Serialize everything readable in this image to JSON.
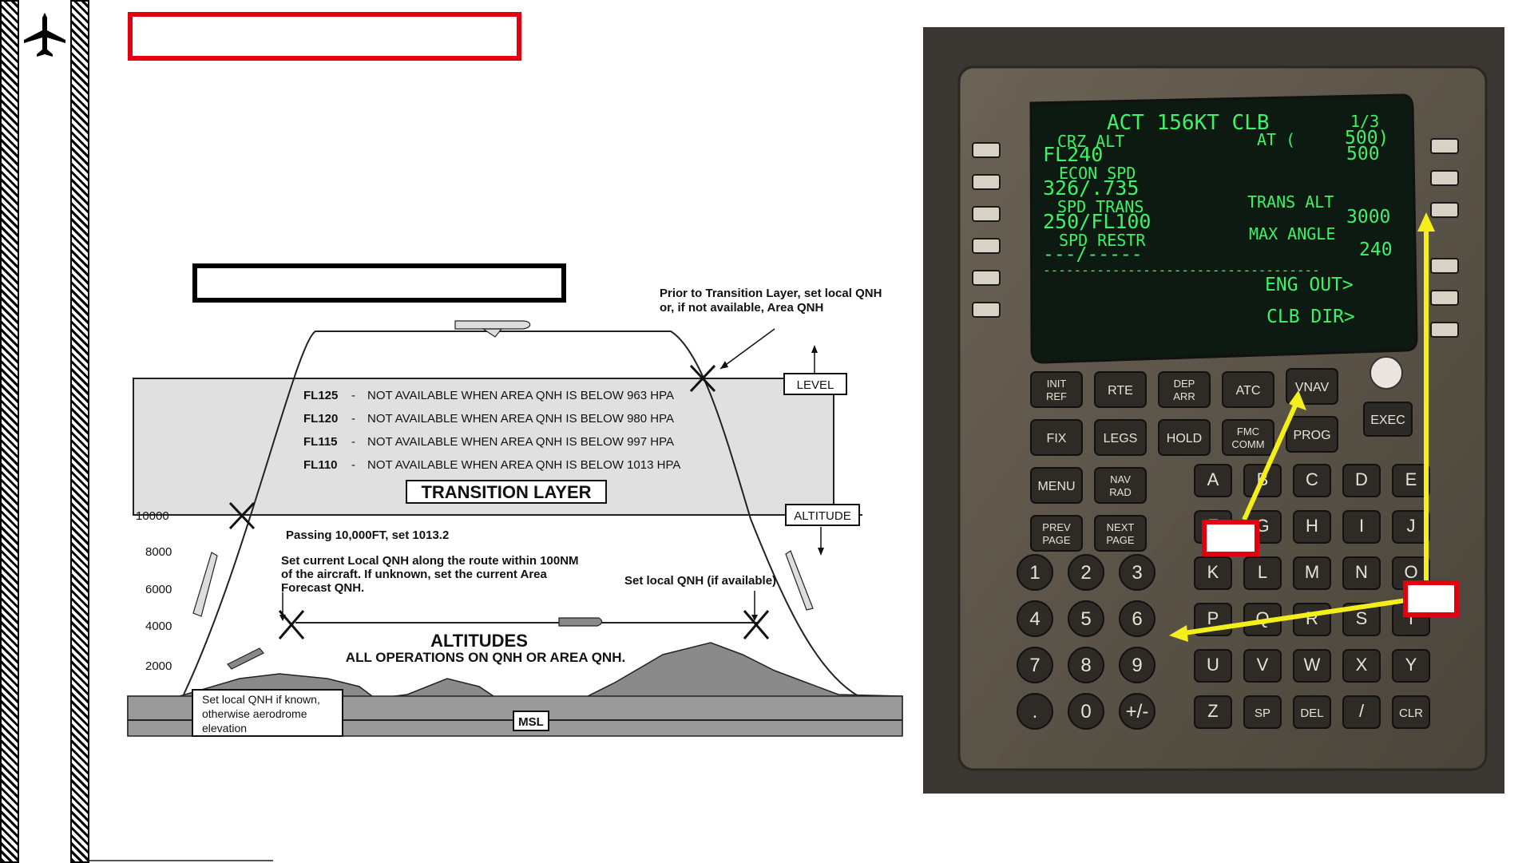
{
  "diagram": {
    "note_top": [
      "Prior to Transition Layer, set local QNH",
      "or, if not  available, Area QNH"
    ],
    "levels": [
      {
        "fl": "FL125",
        "text": "NOT AVAILABLE WHEN AREA QNH IS BELOW 963 HPA"
      },
      {
        "fl": "FL120",
        "text": "NOT AVAILABLE WHEN AREA QNH IS BELOW 980 HPA"
      },
      {
        "fl": "FL115",
        "text": "NOT AVAILABLE WHEN AREA QNH IS BELOW 997 HPA"
      },
      {
        "fl": "FL110",
        "text": "NOT AVAILABLE WHEN AREA QNH IS BELOW 1013 HPA"
      }
    ],
    "dash": "-",
    "transition_layer": "TRANSITION LAYER",
    "level_label": "LEVEL",
    "altitude_label": "ALTITUDE",
    "altitude_ticks": [
      "10000",
      "8000",
      "6000",
      "4000",
      "2000"
    ],
    "passing_note": "Passing 10,000FT,  set  1013.2",
    "qnh_note": [
      "Set  current Local QNH along the route within 100NM",
      "of the aircraft.  If unknown, set the current Area",
      "Forecast QNH."
    ],
    "local_qnh_note": "Set local QNH (if available)",
    "altitudes_title": "ALTITUDES",
    "altitudes_subtitle": "ALL OPERATIONS ON QNH OR AREA QNH.",
    "aerodrome_note": [
      "Set local QNH if known,",
      "otherwise aerodrome",
      "elevation"
    ],
    "msl_label": "MSL"
  },
  "cdu": {
    "screen_lines": [
      "ACT 156KT CLB",
      "1/3",
      "CRZ ALT",
      "AT (",
      "500)",
      "FL240",
      "500",
      "ECON SPD",
      "326/.735",
      "SPD TRANS",
      "TRANS ALT",
      "250/FL100",
      "3000",
      "SPD RESTR",
      "MAX ANGLE",
      "---/-----",
      "240",
      "ENG OUT>",
      "CLB DIR>"
    ],
    "function_keys": [
      "INIT REF",
      "RTE",
      "DEP ARR",
      "ATC",
      "VNAV",
      "FIX",
      "LEGS",
      "HOLD",
      "FMC COMM",
      "PROG",
      "MENU",
      "NAV RAD",
      "PREV PAGE",
      "NEXT PAGE"
    ],
    "exec_label": "EXEC",
    "letters": [
      "A",
      "B",
      "C",
      "D",
      "E",
      "F",
      "G",
      "H",
      "I",
      "J",
      "K",
      "L",
      "M",
      "N",
      "O",
      "P",
      "Q",
      "R",
      "S",
      "T",
      "U",
      "V",
      "W",
      "X",
      "Y",
      "Z",
      "SP",
      "DEL",
      "/",
      "CLR"
    ],
    "numbers": [
      "1",
      "2",
      "3",
      "4",
      "5",
      "6",
      "7",
      "8",
      "9",
      ".",
      "0",
      "+/-"
    ],
    "accent_yellow": "#f4ee1b",
    "accent_red": "#e3000f",
    "screen_green": "#3df266"
  }
}
